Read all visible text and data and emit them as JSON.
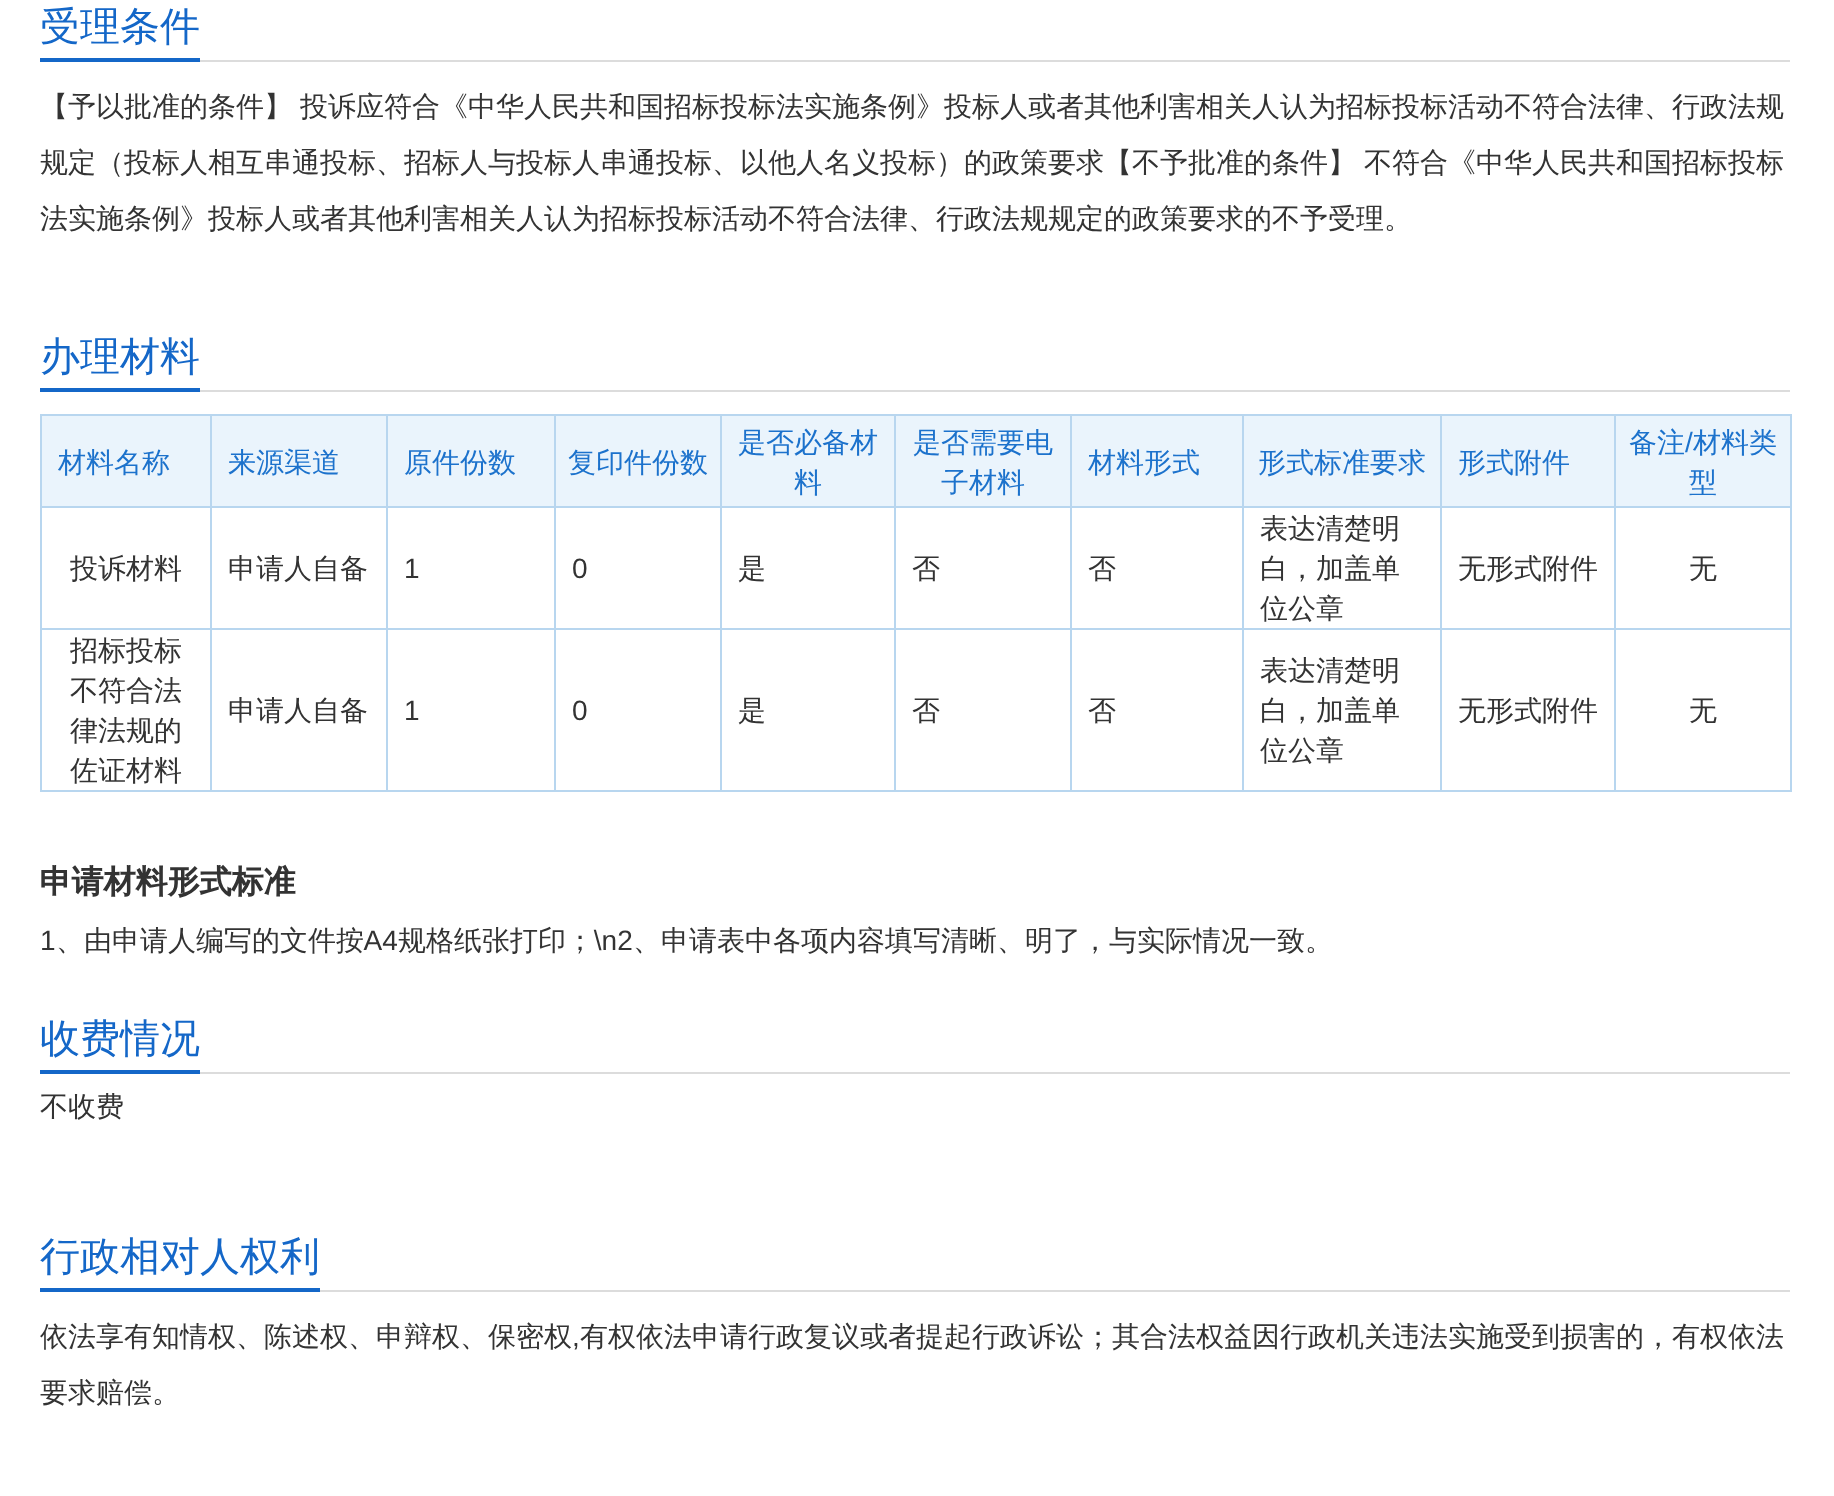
{
  "conditions": {
    "title": "受理条件",
    "text": "【予以批准的条件】 投诉应符合《中华人民共和国招标投标法实施条例》投标人或者其他利害相关人认为招标投标活动不符合法律、行政法规规定（投标人相互串通投标、招标人与投标人串通投标、以他人名义投标）的政策要求【不予批准的条件】 不符合《中华人民共和国招标投标法实施条例》投标人或者其他利害相关人认为招标投标活动不符合法律、行政法规规定的政策要求的不予受理。"
  },
  "materials": {
    "title": "办理材料",
    "table": {
      "columns": [
        "材料名称",
        "来源渠道",
        "原件份数",
        "复印件份数",
        "是否必备材料",
        "是否需要电子材料",
        "材料形式",
        "形式标准要求",
        "形式附件",
        "备注/材料类型"
      ],
      "rows": [
        [
          "投诉材料",
          "申请人自备",
          "1",
          "0",
          "是",
          "否",
          "否",
          "表达清楚明白，加盖单位公章",
          "无形式附件",
          "无"
        ],
        [
          "招标投标不符合法律法规的佐证材料",
          "申请人自备",
          "1",
          "0",
          "是",
          "否",
          "否",
          "表达清楚明白，加盖单位公章",
          "无形式附件",
          "无"
        ]
      ]
    },
    "standard_title": "申请材料形式标准",
    "standard_text": "1、由申请人编写的文件按A4规格纸张打印；\\n2、申请表中各项内容填写清晰、明了，与实际情况一致。"
  },
  "fees": {
    "title": "收费情况",
    "text": "不收费"
  },
  "rights": {
    "title": "行政相对人权利",
    "text": "依法享有知情权、陈述权、申辩权、保密权,有权依法申请行政复议或者提起行政诉讼；其合法权益因行政机关违法实施受到损害的，有权依法要求赔偿。"
  }
}
